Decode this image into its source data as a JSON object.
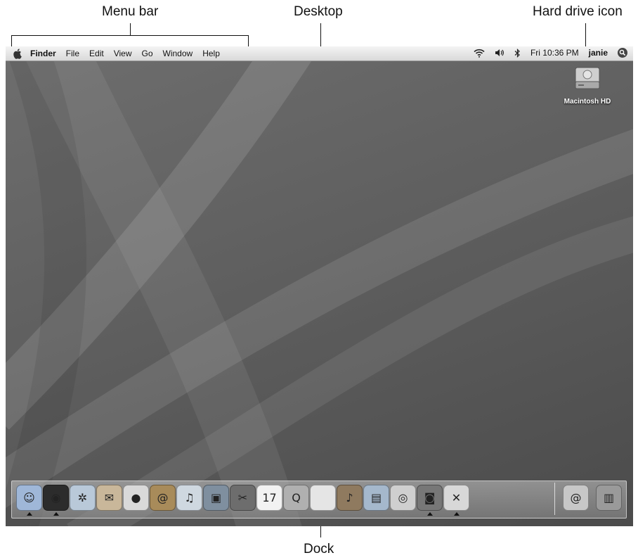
{
  "callouts": {
    "menu_bar": "Menu bar",
    "desktop": "Desktop",
    "hard_drive_icon": "Hard drive icon",
    "dock": "Dock"
  },
  "menubar": {
    "apple_icon": "apple-icon",
    "items": [
      "Finder",
      "File",
      "Edit",
      "View",
      "Go",
      "Window",
      "Help"
    ],
    "status": {
      "wifi_icon": "wifi-icon",
      "volume_icon": "volume-icon",
      "bluetooth_icon": "bluetooth-icon",
      "clock": "Fri 10:36 PM",
      "user": "janie",
      "spotlight_icon": "spotlight-icon"
    }
  },
  "desktop": {
    "hard_drive": {
      "label": "Macintosh HD",
      "icon": "hard-drive-icon"
    }
  },
  "dock": {
    "apps": [
      {
        "name": "finder-icon",
        "color": "#9fb7d8",
        "glyph": "☺",
        "running": true
      },
      {
        "name": "dashboard-icon",
        "color": "#2c2c2c",
        "glyph": "◉",
        "running": true
      },
      {
        "name": "safari-icon",
        "color": "#b9c9d9",
        "glyph": "✲",
        "running": false
      },
      {
        "name": "mail-icon",
        "color": "#c9b79a",
        "glyph": "✉",
        "running": false
      },
      {
        "name": "ichat-icon",
        "color": "#d9d9d9",
        "glyph": "●",
        "running": false
      },
      {
        "name": "address-book-icon",
        "color": "#a88b5a",
        "glyph": "@",
        "running": false
      },
      {
        "name": "itunes-icon",
        "color": "#cfd8e0",
        "glyph": "♫",
        "running": false
      },
      {
        "name": "iphoto-icon",
        "color": "#7f8f9f",
        "glyph": "▣",
        "running": false
      },
      {
        "name": "imovie-icon",
        "color": "#6d6d6d",
        "glyph": "✂",
        "running": false
      },
      {
        "name": "ical-icon",
        "color": "#f2f2f2",
        "glyph": "17",
        "running": false
      },
      {
        "name": "quicktime-icon",
        "color": "#b0b0b0",
        "glyph": "Q",
        "running": false
      },
      {
        "name": "system-preferences-icon",
        "color": "#e5e5e5",
        "glyph": "",
        "running": false
      },
      {
        "name": "garageband-icon",
        "color": "#8f7a5f",
        "glyph": "♪",
        "running": false
      },
      {
        "name": "preview-icon",
        "color": "#a5b8cc",
        "glyph": "▤",
        "running": false
      },
      {
        "name": "dvd-player-icon",
        "color": "#cfcfcf",
        "glyph": "◎",
        "running": false
      },
      {
        "name": "photo-booth-icon",
        "color": "#777777",
        "glyph": "◙",
        "running": true
      },
      {
        "name": "utilities-icon",
        "color": "#d8d8d8",
        "glyph": "✕",
        "running": true
      }
    ],
    "right": [
      {
        "name": "mail-stack-icon",
        "color": "#c7c7c7",
        "glyph": "@"
      },
      {
        "name": "trash-icon",
        "color": "#9a9a9a",
        "glyph": "▥"
      }
    ]
  }
}
